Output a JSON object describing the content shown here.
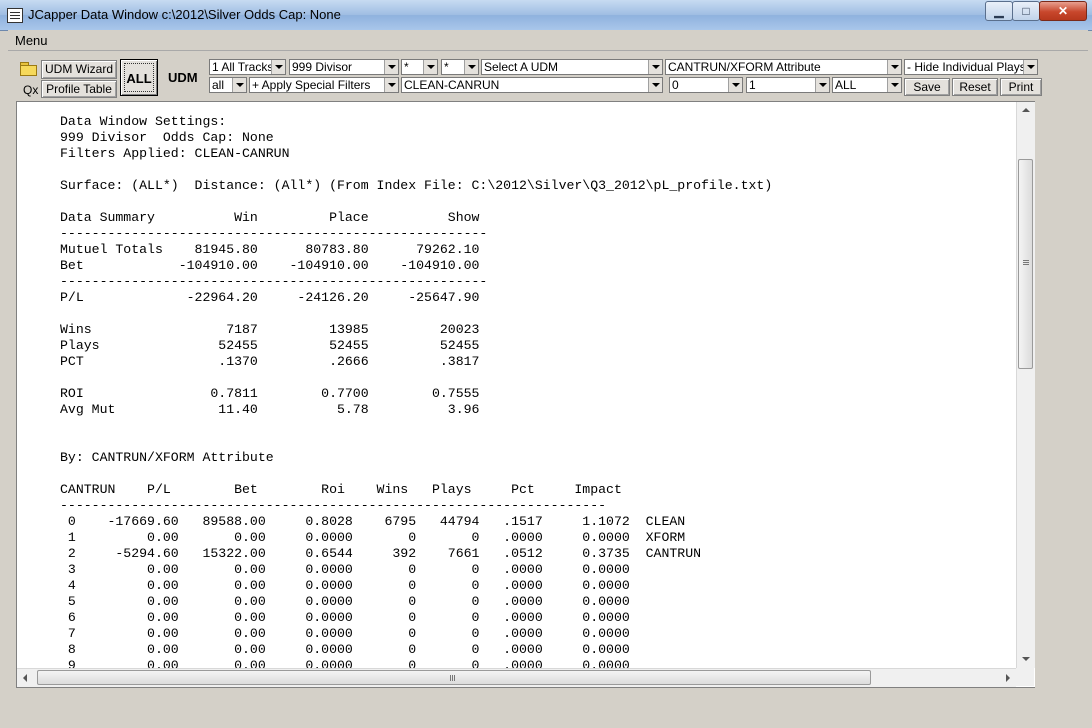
{
  "window": {
    "title": "JCapper Data Window c:\\2012\\Silver Odds Cap: None",
    "controls": {
      "minimize": "▁",
      "maximize": "□",
      "close": "✕"
    }
  },
  "menu": {
    "label": "Menu"
  },
  "toolbar": {
    "udm_wizard": "UDM Wizard",
    "qx": "Qx",
    "profile_table": "Profile Table",
    "all": "ALL",
    "udm": "UDM",
    "combos": {
      "tracks": "1 All Tracks",
      "divisor": "999 Divisor",
      "star1": "*",
      "star2": "*",
      "select_udm": "Select A UDM",
      "attribute": "CANTRUN/XFORM Attribute",
      "hide_plays": "- Hide Individual Plays",
      "all_small": "all",
      "special_filters": "+ Apply Special Filters",
      "clean_canrun": "CLEAN-CANRUN",
      "zero": "0",
      "one": "1",
      "all_right": "ALL"
    },
    "save": "Save",
    "reset": "Reset",
    "print": "Print"
  },
  "report": {
    "lines": [
      "Data Window Settings:",
      "999 Divisor  Odds Cap: None",
      "Filters Applied: CLEAN-CANRUN",
      "",
      "Surface: (ALL*)  Distance: (All*) (From Index File: C:\\2012\\Silver\\Q3_2012\\pL_profile.txt)",
      "",
      "Data Summary          Win         Place          Show",
      "------------------------------------------------------",
      "Mutuel Totals    81945.80      80783.80      79262.10",
      "Bet            -104910.00    -104910.00    -104910.00",
      "------------------------------------------------------",
      "P/L             -22964.20     -24126.20     -25647.90",
      "",
      "Wins                 7187         13985         20023",
      "Plays               52455         52455         52455",
      "PCT                 .1370         .2666         .3817",
      "",
      "ROI                0.7811        0.7700        0.7555",
      "Avg Mut             11.40          5.78          3.96",
      "",
      "",
      "By: CANTRUN/XFORM Attribute",
      "",
      "CANTRUN    P/L        Bet        Roi    Wins   Plays     Pct     Impact",
      "---------------------------------------------------------------------",
      " 0    -17669.60   89588.00     0.8028    6795   44794   .1517     1.1072  CLEAN",
      " 1         0.00       0.00     0.0000       0       0   .0000     0.0000  XFORM",
      " 2     -5294.60   15322.00     0.6544     392    7661   .0512     0.3735  CANTRUN",
      " 3         0.00       0.00     0.0000       0       0   .0000     0.0000",
      " 4         0.00       0.00     0.0000       0       0   .0000     0.0000",
      " 5         0.00       0.00     0.0000       0       0   .0000     0.0000",
      " 6         0.00       0.00     0.0000       0       0   .0000     0.0000",
      " 7         0.00       0.00     0.0000       0       0   .0000     0.0000",
      " 8         0.00       0.00     0.0000       0       0   .0000     0.0000",
      " 9         0.00       0.00     0.0000       0       0   .0000     0.0000"
    ]
  }
}
